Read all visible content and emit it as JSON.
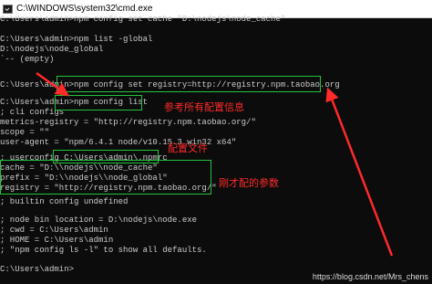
{
  "window": {
    "title": "C:\\WINDOWS\\system32\\cmd.exe"
  },
  "console": {
    "lines": [
      "C:\\Users\\admin>npm config set cache \"D:\\nodejs\\node_cache\"",
      "",
      "C:\\Users\\admin>npm list -global",
      "D:\\nodejs\\node_global",
      "`-- (empty)",
      "",
      "",
      "C:\\Users\\admin>npm config set registry=http://registry.npm.taobao.org",
      "",
      "C:\\Users\\admin>npm config list",
      "; cli configs",
      "metrics-registry = \"http://registry.npm.taobao.org/\"",
      "scope = \"\"",
      "user-agent = \"npm/6.4.1 node/v10.15.3 win32 x64\"",
      "",
      "; userconfig C:\\Users\\admin\\.npmrc",
      "cache = \"D:\\\\nodejs\\\\node_cache\"",
      "prefix = \"D:\\\\nodejs\\\\node_global\"",
      "registry = \"http://registry.npm.taobao.org/\"",
      "",
      "; builtin config undefined",
      "",
      "; node bin location = D:\\nodejs\\node.exe",
      "; cwd = C:\\Users\\admin",
      "; HOME = C:\\Users\\admin",
      "; \"npm config ls -l\" to show all defaults.",
      "",
      "",
      "C:\\Users\\admin>"
    ]
  },
  "annotations": {
    "note_all_config": "参考所有配置信息",
    "note_config_file": "配置文件",
    "note_just_configured": "刚才配的参数"
  },
  "watermark": "https://blog.csdn.net/Mrs_chens",
  "colors": {
    "background": "#0c0c0c",
    "text": "#cccccc",
    "highlight_box": "#22c33a",
    "annotation": "#ff2a2a"
  }
}
